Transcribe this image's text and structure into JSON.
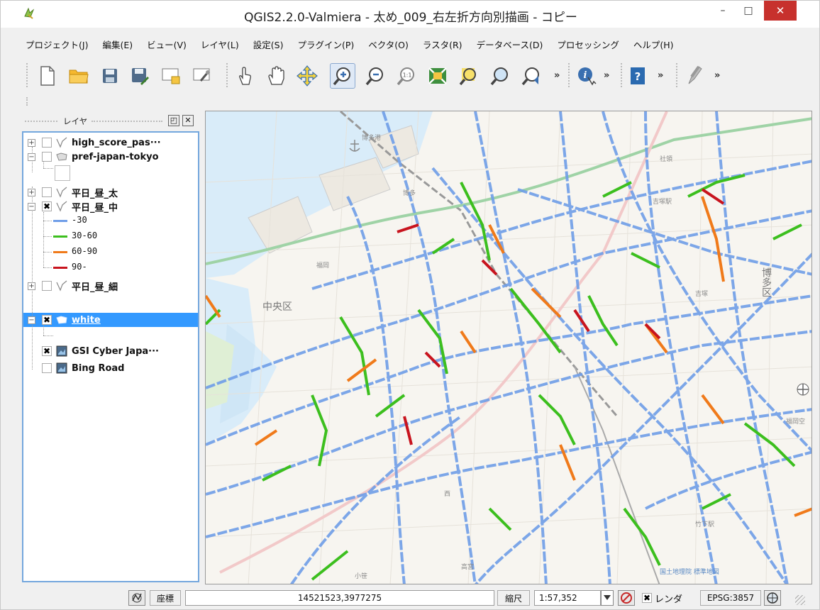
{
  "window": {
    "title": "QGIS2.2.0-Valmiera - 太め_009_右左折方向別描画 - コピー",
    "minimize_symbol": "–",
    "maximize_symbol": "□",
    "close_symbol": "✕"
  },
  "menubar": {
    "items": [
      "プロジェクト(J)",
      "編集(E)",
      "ビュー(V)",
      "レイヤ(L)",
      "設定(S)",
      "プラグイン(P)",
      "ベクタ(O)",
      "ラスタ(R)",
      "データベース(D)",
      "プロセッシング",
      "ヘルプ(H)"
    ]
  },
  "toolbar": {
    "icons": [
      "new-project-icon",
      "open-folder-icon",
      "save-icon",
      "save-as-icon",
      "new-print-composer-icon",
      "composer-manager-icon",
      "touch-icon",
      "pan-hand-icon",
      "pan-to-selection-icon",
      "zoom-in-icon",
      "zoom-out-icon",
      "zoom-actual-icon",
      "zoom-full-icon",
      "zoom-to-selection-icon",
      "zoom-to-layer-icon",
      "zoom-last-icon",
      "identify-icon",
      "help-icon",
      "digitize-icon"
    ],
    "more_symbol": "»"
  },
  "layers_panel": {
    "title": "レイヤ",
    "layers": [
      {
        "name": "high_score_pas···",
        "checked": false,
        "icon": "line-layer-icon"
      },
      {
        "name": "pref-japan-tokyo",
        "checked": false,
        "icon": "polygon-layer-icon"
      },
      {
        "name": "平日_昼_太",
        "checked": false,
        "icon": "line-layer-icon"
      },
      {
        "name": "平日_昼_中",
        "checked": true,
        "icon": "line-layer-icon"
      },
      {
        "name": "平日_昼_細",
        "checked": false,
        "icon": "line-layer-icon"
      },
      {
        "name": "white",
        "checked": true,
        "icon": "polygon-layer-icon"
      },
      {
        "name": "GSI Cyber Japa···",
        "checked": true,
        "icon": "raster-layer-icon"
      },
      {
        "name": "Bing Road",
        "checked": false,
        "icon": "raster-layer-icon"
      }
    ],
    "legend": [
      {
        "label": "-30",
        "color": "#6f9ee8"
      },
      {
        "label": "30-60",
        "color": "#3cbf1e"
      },
      {
        "label": "60-90",
        "color": "#f07a1a"
      },
      {
        "label": "90-",
        "color": "#c8141e"
      }
    ],
    "check_symbol": "✖"
  },
  "map": {
    "labels": [
      "博多港",
      "社領",
      "博多",
      "吉塚駅",
      "福岡",
      "中央区",
      "博多区",
      "吉塚",
      "福岡空",
      "高宮",
      "小笹",
      "竹下駅",
      "西",
      "国土地理院 標準地図"
    ]
  },
  "statusbar": {
    "coord_label": "座標",
    "coord_value": "14521523,3977275",
    "scale_label": "縮尺",
    "scale_value": "1:57,352",
    "render_label": "レンダ",
    "render_checked": "✖",
    "crs": "EPSG:3857"
  },
  "colors": {
    "selection": "#3399ff",
    "close_button": "#c7312d",
    "speed_low": "#6f9ee8",
    "speed_mid": "#3cbf1e",
    "speed_high": "#f07a1a",
    "speed_top": "#c8141e"
  }
}
